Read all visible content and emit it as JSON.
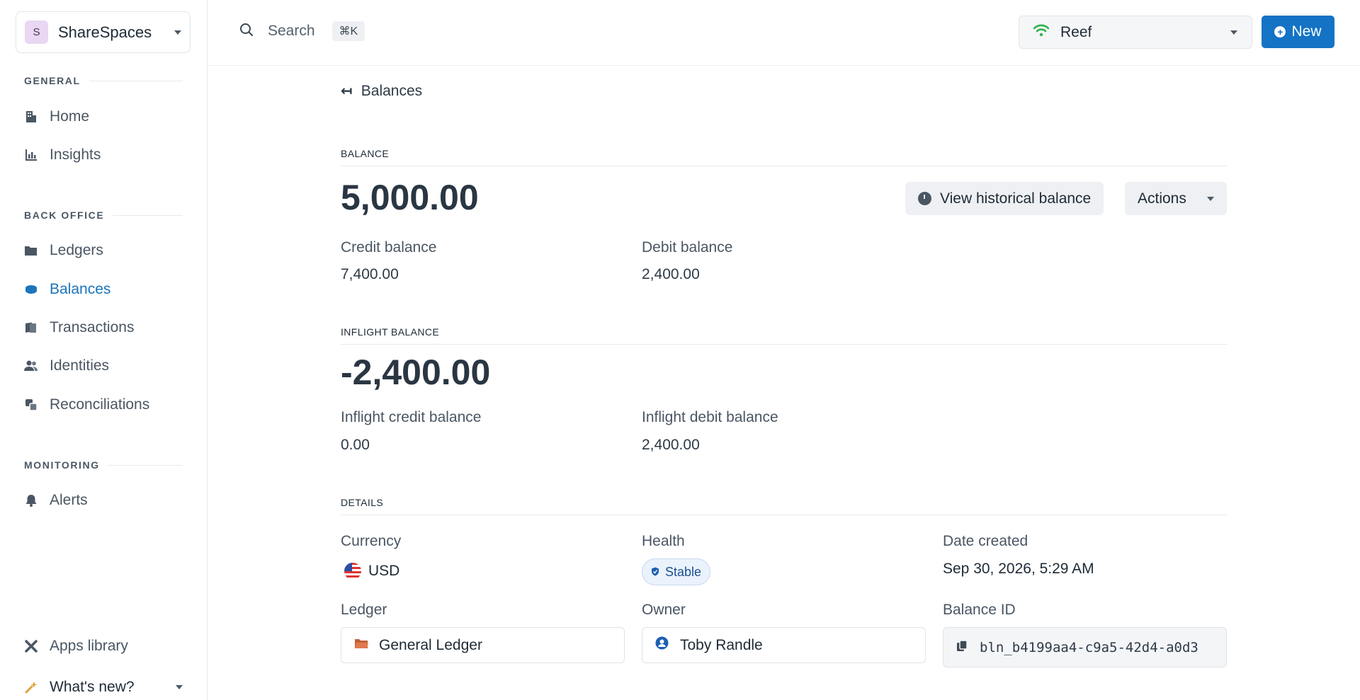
{
  "workspace": {
    "initial": "S",
    "name": "ShareSpaces"
  },
  "sidebar": {
    "sections": [
      {
        "label": "GENERAL"
      },
      {
        "label": "BACK OFFICE"
      },
      {
        "label": "MONITORING"
      }
    ],
    "items": [
      {
        "label": "Home",
        "icon": "building-icon"
      },
      {
        "label": "Insights",
        "icon": "bar-chart-icon"
      },
      {
        "label": "Ledgers",
        "icon": "folder-icon"
      },
      {
        "label": "Balances",
        "icon": "coins-icon",
        "active": true
      },
      {
        "label": "Transactions",
        "icon": "documents-icon"
      },
      {
        "label": "Identities",
        "icon": "users-icon"
      },
      {
        "label": "Reconciliations",
        "icon": "reconcile-icon"
      },
      {
        "label": "Alerts",
        "icon": "bell-icon"
      }
    ],
    "footer": {
      "apps": "Apps library",
      "whats_new": "What's new?"
    }
  },
  "topbar": {
    "search_label": "Search",
    "shortcut": "⌘K",
    "environment": "Reef",
    "new_label": "New"
  },
  "main": {
    "back_label": "Balances",
    "balance": {
      "header": "BALANCE",
      "amount": "5,000.00",
      "view_history_label": "View historical balance",
      "actions_label": "Actions",
      "credit_label": "Credit balance",
      "credit_value": "7,400.00",
      "debit_label": "Debit balance",
      "debit_value": "2,400.00"
    },
    "inflight": {
      "header": "INFLIGHT BALANCE",
      "amount": "-2,400.00",
      "credit_label": "Inflight credit balance",
      "credit_value": "0.00",
      "debit_label": "Inflight debit balance",
      "debit_value": "2,400.00"
    },
    "details": {
      "header": "DETAILS",
      "currency_label": "Currency",
      "currency_value": "USD",
      "health_label": "Health",
      "health_value": "Stable",
      "date_label": "Date created",
      "date_value": "Sep 30, 2026, 5:29 AM",
      "ledger_label": "Ledger",
      "ledger_value": "General Ledger",
      "owner_label": "Owner",
      "owner_value": "Toby Randle",
      "balance_id_label": "Balance ID",
      "balance_id_value": "bln_b4199aa4-c9a5-42d4-a0d3"
    }
  },
  "colors": {
    "accent": "#1473c5",
    "active_nav": "#1b74bb",
    "env_signal": "#2fb24c"
  }
}
